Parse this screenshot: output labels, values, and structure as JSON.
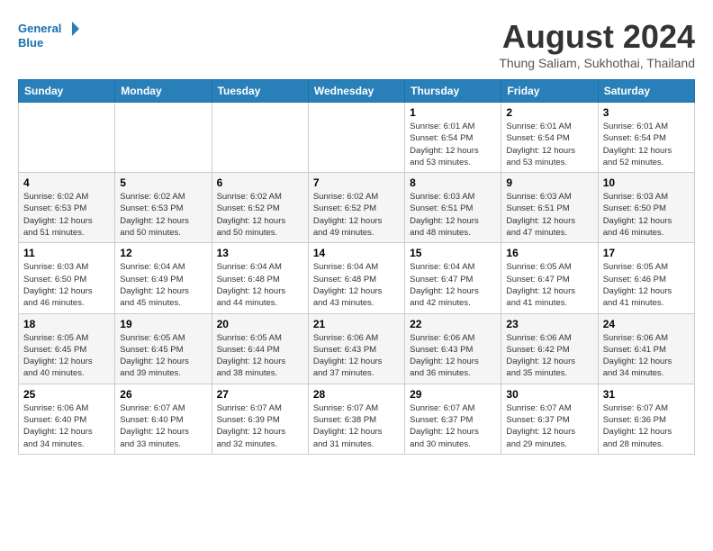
{
  "header": {
    "logo_line1": "General",
    "logo_line2": "Blue",
    "month_year": "August 2024",
    "location": "Thung Saliam, Sukhothai, Thailand"
  },
  "weekdays": [
    "Sunday",
    "Monday",
    "Tuesday",
    "Wednesday",
    "Thursday",
    "Friday",
    "Saturday"
  ],
  "weeks": [
    [
      {
        "day": "",
        "info": ""
      },
      {
        "day": "",
        "info": ""
      },
      {
        "day": "",
        "info": ""
      },
      {
        "day": "",
        "info": ""
      },
      {
        "day": "1",
        "info": "Sunrise: 6:01 AM\nSunset: 6:54 PM\nDaylight: 12 hours\nand 53 minutes."
      },
      {
        "day": "2",
        "info": "Sunrise: 6:01 AM\nSunset: 6:54 PM\nDaylight: 12 hours\nand 53 minutes."
      },
      {
        "day": "3",
        "info": "Sunrise: 6:01 AM\nSunset: 6:54 PM\nDaylight: 12 hours\nand 52 minutes."
      }
    ],
    [
      {
        "day": "4",
        "info": "Sunrise: 6:02 AM\nSunset: 6:53 PM\nDaylight: 12 hours\nand 51 minutes."
      },
      {
        "day": "5",
        "info": "Sunrise: 6:02 AM\nSunset: 6:53 PM\nDaylight: 12 hours\nand 50 minutes."
      },
      {
        "day": "6",
        "info": "Sunrise: 6:02 AM\nSunset: 6:52 PM\nDaylight: 12 hours\nand 50 minutes."
      },
      {
        "day": "7",
        "info": "Sunrise: 6:02 AM\nSunset: 6:52 PM\nDaylight: 12 hours\nand 49 minutes."
      },
      {
        "day": "8",
        "info": "Sunrise: 6:03 AM\nSunset: 6:51 PM\nDaylight: 12 hours\nand 48 minutes."
      },
      {
        "day": "9",
        "info": "Sunrise: 6:03 AM\nSunset: 6:51 PM\nDaylight: 12 hours\nand 47 minutes."
      },
      {
        "day": "10",
        "info": "Sunrise: 6:03 AM\nSunset: 6:50 PM\nDaylight: 12 hours\nand 46 minutes."
      }
    ],
    [
      {
        "day": "11",
        "info": "Sunrise: 6:03 AM\nSunset: 6:50 PM\nDaylight: 12 hours\nand 46 minutes."
      },
      {
        "day": "12",
        "info": "Sunrise: 6:04 AM\nSunset: 6:49 PM\nDaylight: 12 hours\nand 45 minutes."
      },
      {
        "day": "13",
        "info": "Sunrise: 6:04 AM\nSunset: 6:48 PM\nDaylight: 12 hours\nand 44 minutes."
      },
      {
        "day": "14",
        "info": "Sunrise: 6:04 AM\nSunset: 6:48 PM\nDaylight: 12 hours\nand 43 minutes."
      },
      {
        "day": "15",
        "info": "Sunrise: 6:04 AM\nSunset: 6:47 PM\nDaylight: 12 hours\nand 42 minutes."
      },
      {
        "day": "16",
        "info": "Sunrise: 6:05 AM\nSunset: 6:47 PM\nDaylight: 12 hours\nand 41 minutes."
      },
      {
        "day": "17",
        "info": "Sunrise: 6:05 AM\nSunset: 6:46 PM\nDaylight: 12 hours\nand 41 minutes."
      }
    ],
    [
      {
        "day": "18",
        "info": "Sunrise: 6:05 AM\nSunset: 6:45 PM\nDaylight: 12 hours\nand 40 minutes."
      },
      {
        "day": "19",
        "info": "Sunrise: 6:05 AM\nSunset: 6:45 PM\nDaylight: 12 hours\nand 39 minutes."
      },
      {
        "day": "20",
        "info": "Sunrise: 6:05 AM\nSunset: 6:44 PM\nDaylight: 12 hours\nand 38 minutes."
      },
      {
        "day": "21",
        "info": "Sunrise: 6:06 AM\nSunset: 6:43 PM\nDaylight: 12 hours\nand 37 minutes."
      },
      {
        "day": "22",
        "info": "Sunrise: 6:06 AM\nSunset: 6:43 PM\nDaylight: 12 hours\nand 36 minutes."
      },
      {
        "day": "23",
        "info": "Sunrise: 6:06 AM\nSunset: 6:42 PM\nDaylight: 12 hours\nand 35 minutes."
      },
      {
        "day": "24",
        "info": "Sunrise: 6:06 AM\nSunset: 6:41 PM\nDaylight: 12 hours\nand 34 minutes."
      }
    ],
    [
      {
        "day": "25",
        "info": "Sunrise: 6:06 AM\nSunset: 6:40 PM\nDaylight: 12 hours\nand 34 minutes."
      },
      {
        "day": "26",
        "info": "Sunrise: 6:07 AM\nSunset: 6:40 PM\nDaylight: 12 hours\nand 33 minutes."
      },
      {
        "day": "27",
        "info": "Sunrise: 6:07 AM\nSunset: 6:39 PM\nDaylight: 12 hours\nand 32 minutes."
      },
      {
        "day": "28",
        "info": "Sunrise: 6:07 AM\nSunset: 6:38 PM\nDaylight: 12 hours\nand 31 minutes."
      },
      {
        "day": "29",
        "info": "Sunrise: 6:07 AM\nSunset: 6:37 PM\nDaylight: 12 hours\nand 30 minutes."
      },
      {
        "day": "30",
        "info": "Sunrise: 6:07 AM\nSunset: 6:37 PM\nDaylight: 12 hours\nand 29 minutes."
      },
      {
        "day": "31",
        "info": "Sunrise: 6:07 AM\nSunset: 6:36 PM\nDaylight: 12 hours\nand 28 minutes."
      }
    ]
  ]
}
